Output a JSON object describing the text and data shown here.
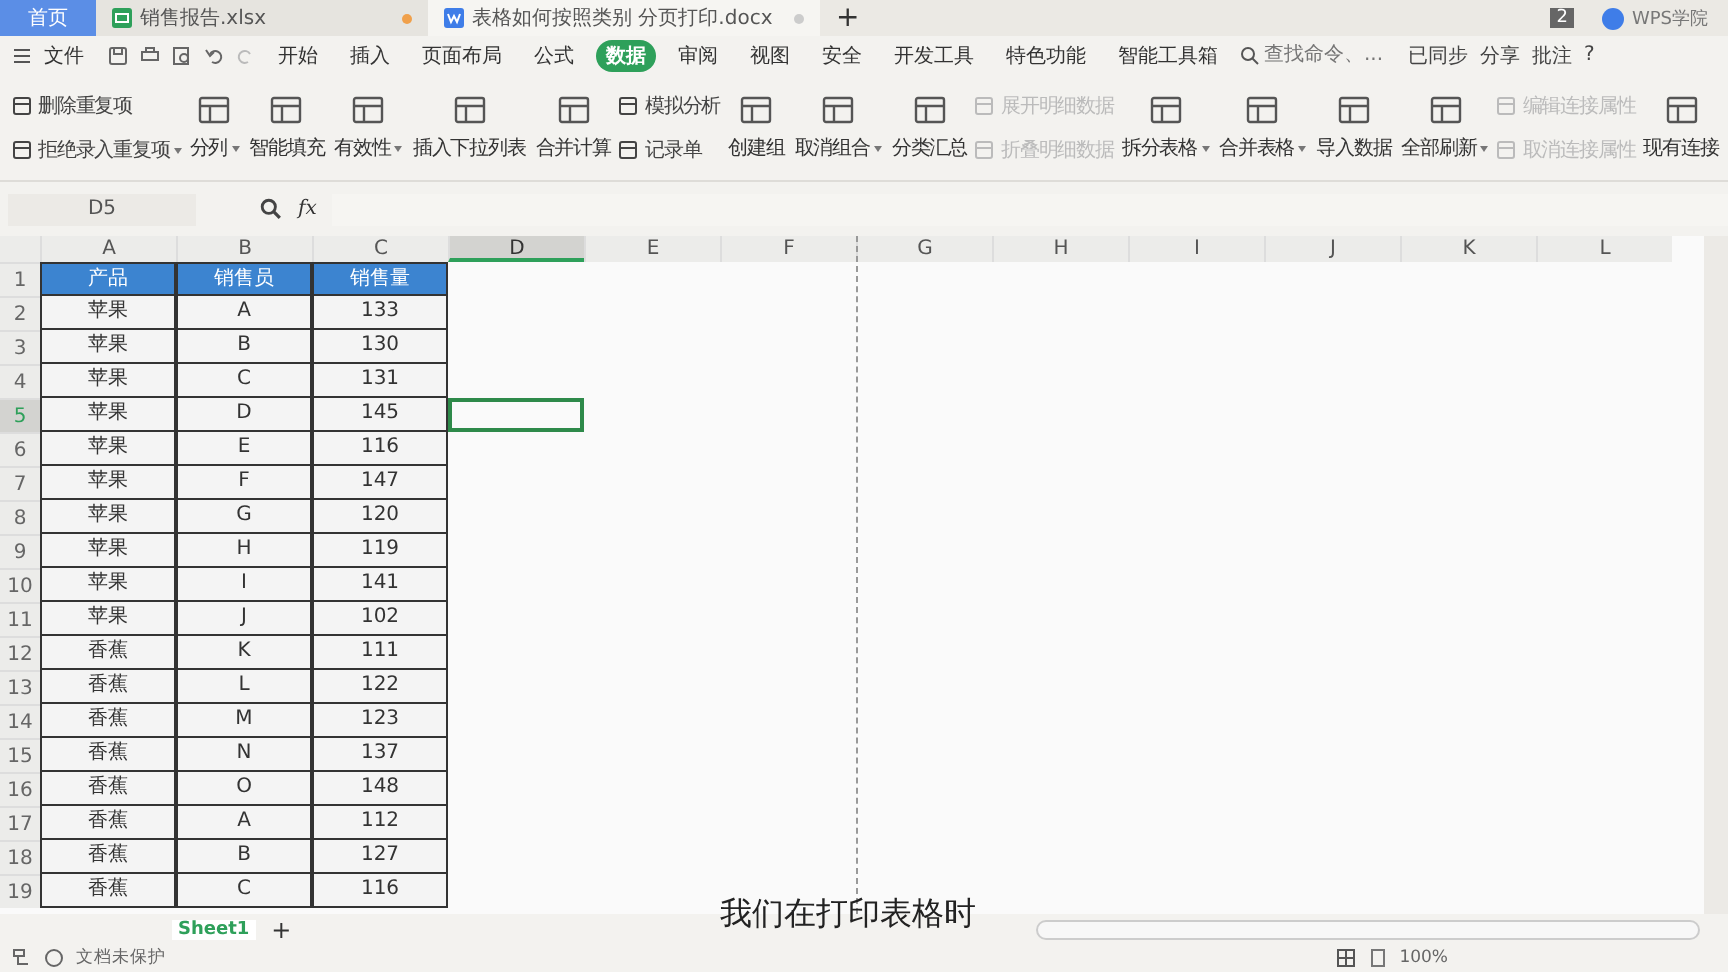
{
  "tabs": [
    {
      "label": "首页",
      "kind": "home",
      "selected": false
    },
    {
      "label": "销售报告.xlsx",
      "kind": "sheet",
      "selected": false,
      "modified": true
    },
    {
      "label": "表格如何按照类别 分页打印.docx",
      "kind": "doc",
      "selected": true,
      "modified": false
    }
  ],
  "new_tab": "+",
  "account": {
    "badge": "2",
    "name": "WPS学院"
  },
  "file_menu": "文件",
  "menu": [
    {
      "label": "开始",
      "selected": false
    },
    {
      "label": "插入",
      "selected": false
    },
    {
      "label": "页面布局",
      "selected": false
    },
    {
      "label": "公式",
      "selected": false
    },
    {
      "label": "数据",
      "selected": true
    },
    {
      "label": "审阅",
      "selected": false
    },
    {
      "label": "视图",
      "selected": false
    },
    {
      "label": "安全",
      "selected": false
    },
    {
      "label": "开发工具",
      "selected": false
    },
    {
      "label": "特色功能",
      "selected": false
    },
    {
      "label": "智能工具箱",
      "selected": false
    }
  ],
  "search": {
    "placeholder": "查找命令、..."
  },
  "right_actions": [
    "已同步",
    "分享",
    "批注"
  ],
  "help": "?",
  "ribbon": [
    {
      "kind": "stack",
      "items": [
        {
          "label": "删除重复项",
          "disabled": false,
          "dropdown": false
        },
        {
          "label": "拒绝录入重复项",
          "disabled": false,
          "dropdown": true
        }
      ]
    },
    {
      "kind": "large",
      "label": "分列",
      "disabled": false,
      "dropdown": true
    },
    {
      "kind": "large",
      "label": "智能填充",
      "disabled": false,
      "dropdown": false
    },
    {
      "kind": "large",
      "label": "有效性",
      "disabled": false,
      "dropdown": true
    },
    {
      "kind": "large",
      "label": "插入下拉列表",
      "disabled": false,
      "dropdown": false
    },
    {
      "kind": "large",
      "label": "合并计算",
      "disabled": false,
      "dropdown": false
    },
    {
      "kind": "stack",
      "items": [
        {
          "label": "模拟分析",
          "disabled": false,
          "dropdown": false
        },
        {
          "label": "记录单",
          "disabled": false,
          "dropdown": false
        }
      ]
    },
    {
      "kind": "large",
      "label": "创建组",
      "disabled": false,
      "dropdown": false
    },
    {
      "kind": "large",
      "label": "取消组合",
      "disabled": false,
      "dropdown": true
    },
    {
      "kind": "large",
      "label": "分类汇总",
      "disabled": false,
      "dropdown": false
    },
    {
      "kind": "stack",
      "items": [
        {
          "label": "展开明细数据",
          "disabled": true,
          "dropdown": false
        },
        {
          "label": "折叠明细数据",
          "disabled": true,
          "dropdown": false
        }
      ]
    },
    {
      "kind": "large",
      "label": "拆分表格",
      "disabled": false,
      "dropdown": true
    },
    {
      "kind": "large",
      "label": "合并表格",
      "disabled": false,
      "dropdown": true
    },
    {
      "kind": "large",
      "label": "导入数据",
      "disabled": false,
      "dropdown": false
    },
    {
      "kind": "large",
      "label": "全部刷新",
      "disabled": false,
      "dropdown": true
    },
    {
      "kind": "stack",
      "items": [
        {
          "label": "编辑连接属性",
          "disabled": true,
          "dropdown": false
        },
        {
          "label": "取消连接属性",
          "disabled": true,
          "dropdown": false
        }
      ]
    },
    {
      "kind": "large",
      "label": "现有连接",
      "disabled": false,
      "dropdown": false
    }
  ],
  "name_box": "D5",
  "fx": "fx",
  "columns": [
    {
      "label": "A",
      "selected": false,
      "page_break": false
    },
    {
      "label": "B",
      "selected": false,
      "page_break": false
    },
    {
      "label": "C",
      "selected": false,
      "page_break": false
    },
    {
      "label": "D",
      "selected": true,
      "page_break": false
    },
    {
      "label": "E",
      "selected": false,
      "page_break": false
    },
    {
      "label": "F",
      "selected": false,
      "page_break": false
    },
    {
      "label": "G",
      "selected": false,
      "page_break": true
    },
    {
      "label": "H",
      "selected": false,
      "page_break": false
    },
    {
      "label": "I",
      "selected": false,
      "page_break": false
    },
    {
      "label": "J",
      "selected": false,
      "page_break": false
    },
    {
      "label": "K",
      "selected": false,
      "page_break": false
    },
    {
      "label": "L",
      "selected": false,
      "page_break": false
    }
  ],
  "rows": [
    {
      "number": "1",
      "selected": false,
      "header": true,
      "cells": [
        "产品",
        "销售员",
        "销售量"
      ]
    },
    {
      "number": "2",
      "selected": false,
      "header": false,
      "cells": [
        "苹果",
        "A",
        "133"
      ]
    },
    {
      "number": "3",
      "selected": false,
      "header": false,
      "cells": [
        "苹果",
        "B",
        "130"
      ]
    },
    {
      "number": "4",
      "selected": false,
      "header": false,
      "cells": [
        "苹果",
        "C",
        "131"
      ]
    },
    {
      "number": "5",
      "selected": true,
      "header": false,
      "cells": [
        "苹果",
        "D",
        "145"
      ]
    },
    {
      "number": "6",
      "selected": false,
      "header": false,
      "cells": [
        "苹果",
        "E",
        "116"
      ]
    },
    {
      "number": "7",
      "selected": false,
      "header": false,
      "cells": [
        "苹果",
        "F",
        "147"
      ]
    },
    {
      "number": "8",
      "selected": false,
      "header": false,
      "cells": [
        "苹果",
        "G",
        "120"
      ]
    },
    {
      "number": "9",
      "selected": false,
      "header": false,
      "cells": [
        "苹果",
        "H",
        "119"
      ]
    },
    {
      "number": "10",
      "selected": false,
      "header": false,
      "cells": [
        "苹果",
        "I",
        "141"
      ]
    },
    {
      "number": "11",
      "selected": false,
      "header": false,
      "cells": [
        "苹果",
        "J",
        "102"
      ]
    },
    {
      "number": "12",
      "selected": false,
      "header": false,
      "cells": [
        "香蕉",
        "K",
        "111"
      ]
    },
    {
      "number": "13",
      "selected": false,
      "header": false,
      "cells": [
        "香蕉",
        "L",
        "122"
      ]
    },
    {
      "number": "14",
      "selected": false,
      "header": false,
      "cells": [
        "香蕉",
        "M",
        "123"
      ]
    },
    {
      "number": "15",
      "selected": false,
      "header": false,
      "cells": [
        "香蕉",
        "N",
        "137"
      ]
    },
    {
      "number": "16",
      "selected": false,
      "header": false,
      "cells": [
        "香蕉",
        "O",
        "148"
      ]
    },
    {
      "number": "17",
      "selected": false,
      "header": false,
      "cells": [
        "香蕉",
        "A",
        "112"
      ]
    },
    {
      "number": "18",
      "selected": false,
      "header": false,
      "cells": [
        "香蕉",
        "B",
        "127"
      ]
    },
    {
      "number": "19",
      "selected": false,
      "header": false,
      "cells": [
        "香蕉",
        "C",
        "116"
      ]
    }
  ],
  "sheet_tabs": [
    {
      "label": "Sheet1",
      "selected": true
    }
  ],
  "add_sheet": "+",
  "status": "文档未保护",
  "zoom": "100%",
  "subtitle": "我们在打印表格时"
}
